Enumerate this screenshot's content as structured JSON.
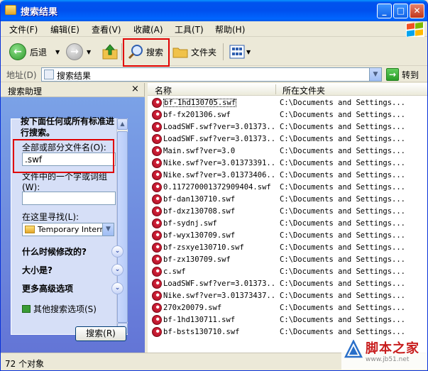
{
  "window": {
    "title": "搜索结果",
    "controls": {
      "minimize": "_",
      "maximize": "□",
      "close": "✕"
    }
  },
  "menu": [
    "文件(F)",
    "编辑(E)",
    "查看(V)",
    "收藏(A)",
    "工具(T)",
    "帮助(H)"
  ],
  "toolbar": {
    "back": "后退",
    "search": "搜索",
    "folders": "文件夹"
  },
  "address": {
    "label": "地址(D)",
    "value": "搜索结果",
    "go": "转到"
  },
  "left_pane": {
    "title": "搜索助理",
    "close": "×",
    "question": "按下面任何或所有标准进行搜索。",
    "filename_label": "全部或部分文件名(O):",
    "filename_value": ".swf",
    "phrase_label": "文件中的一个字或词组(W):",
    "phrase_value": "",
    "lookin_label": "在这里寻找(L):",
    "lookin_value": "Temporary Interne",
    "options": [
      "什么时候修改的?",
      "大小是?",
      "更多高级选项"
    ],
    "more_search": "其他搜索选项(S)",
    "search_button": "搜索(R)"
  },
  "columns": {
    "name": "名称",
    "folder": "所在文件夹"
  },
  "files": [
    {
      "name": "bf-1hd130705.swf",
      "folder": "C:\\Documents and Settings..."
    },
    {
      "name": "bf-fx201306.swf",
      "folder": "C:\\Documents and Settings..."
    },
    {
      "name": "LoadSWF.swf?ver=3.01373...",
      "folder": "C:\\Documents and Settings..."
    },
    {
      "name": "LoadSWF.swf?ver=3.01373...",
      "folder": "C:\\Documents and Settings..."
    },
    {
      "name": "Main.swf?ver=3.0",
      "folder": "C:\\Documents and Settings..."
    },
    {
      "name": "Nike.swf?ver=3.01373391...",
      "folder": "C:\\Documents and Settings..."
    },
    {
      "name": "Nike.swf?ver=3.01373406...",
      "folder": "C:\\Documents and Settings..."
    },
    {
      "name": "0.117270001372909404.swf",
      "folder": "C:\\Documents and Settings..."
    },
    {
      "name": "bf-dan130710.swf",
      "folder": "C:\\Documents and Settings..."
    },
    {
      "name": "bf-dxz130708.swf",
      "folder": "C:\\Documents and Settings..."
    },
    {
      "name": "bf-sydnj.swf",
      "folder": "C:\\Documents and Settings..."
    },
    {
      "name": "bf-wyx130709.swf",
      "folder": "C:\\Documents and Settings..."
    },
    {
      "name": "bf-zsxye130710.swf",
      "folder": "C:\\Documents and Settings..."
    },
    {
      "name": "bf-zx130709.swf",
      "folder": "C:\\Documents and Settings..."
    },
    {
      "name": "c.swf",
      "folder": "C:\\Documents and Settings..."
    },
    {
      "name": "LoadSWF.swf?ver=3.01373...",
      "folder": "C:\\Documents and Settings..."
    },
    {
      "name": "Nike.swf?ver=3.01373437...",
      "folder": "C:\\Documents and Settings..."
    },
    {
      "name": "270x20079.swf",
      "folder": "C:\\Documents and Settings..."
    },
    {
      "name": "bf-1hd130711.swf",
      "folder": "C:\\Documents and Settings..."
    },
    {
      "name": "bf-bsts130710.swf",
      "folder": "C:\\Documents and Settings..."
    }
  ],
  "status": "72 个对象",
  "watermark": {
    "name": "脚本之家",
    "url": "www.jb51.net"
  }
}
